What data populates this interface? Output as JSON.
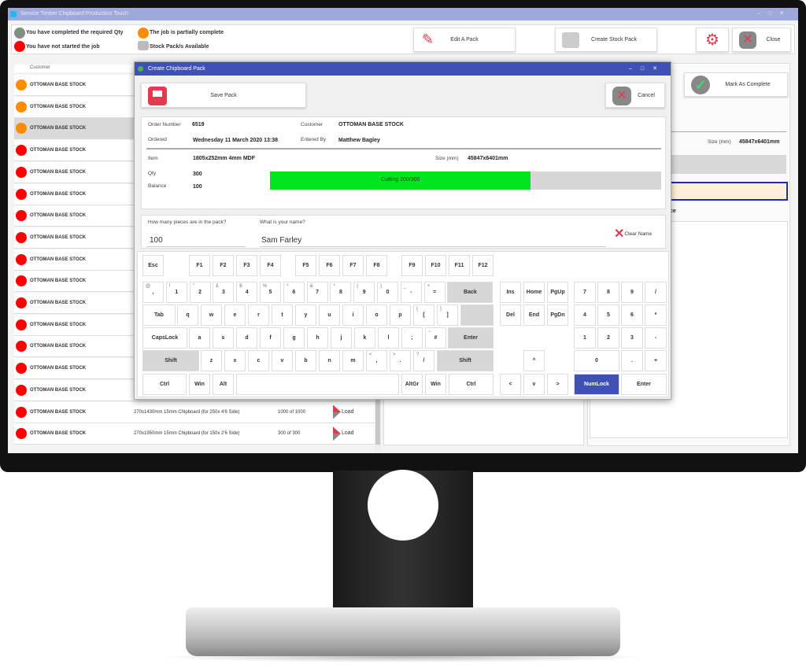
{
  "window": {
    "title": "Service Timber Chipboard Production Touch"
  },
  "legend": {
    "completed": "You have completed the required Qty",
    "partial": "The job is partially complete",
    "not_started": "You have not started the job",
    "stock_pack": "Stock Pack/s Available"
  },
  "toolbar": {
    "edit_pack": "Edit A Pack",
    "create_stock_pack": "Create Stock Pack",
    "close": "Close"
  },
  "list": {
    "header": "Customer",
    "rows": [
      {
        "customer": "OTTOMAN BASE STOCK",
        "status": "orange"
      },
      {
        "customer": "OTTOMAN BASE STOCK",
        "status": "orange"
      },
      {
        "customer": "OTTOMAN BASE STOCK",
        "status": "orange",
        "selected": true
      },
      {
        "customer": "OTTOMAN BASE STOCK",
        "status": "red"
      },
      {
        "customer": "OTTOMAN BASE STOCK",
        "status": "red"
      },
      {
        "customer": "OTTOMAN BASE STOCK",
        "status": "red"
      },
      {
        "customer": "OTTOMAN BASE STOCK",
        "status": "red"
      },
      {
        "customer": "OTTOMAN BASE STOCK",
        "status": "red"
      },
      {
        "customer": "OTTOMAN BASE STOCK",
        "status": "red"
      },
      {
        "customer": "OTTOMAN BASE STOCK",
        "status": "red"
      },
      {
        "customer": "OTTOMAN BASE STOCK",
        "status": "red"
      },
      {
        "customer": "OTTOMAN BASE STOCK",
        "status": "red"
      },
      {
        "customer": "OTTOMAN BASE STOCK",
        "status": "red"
      },
      {
        "customer": "OTTOMAN BASE STOCK",
        "status": "red"
      },
      {
        "customer": "OTTOMAN BASE STOCK",
        "status": "red"
      },
      {
        "customer": "OTTOMAN BASE STOCK",
        "status": "red",
        "item": "270x1430mm 15mm Chipboard (for 250x 4'6 Side)",
        "qty": "1000 of 1000",
        "action": "Load"
      },
      {
        "customer": "OTTOMAN BASE STOCK",
        "status": "red",
        "item": "270x1950mm 15mm Chipboard (for 150x 2'6 Side)",
        "qty": "300 of 300",
        "action": "Load"
      }
    ]
  },
  "right": {
    "mark_complete": "Mark As Complete",
    "size_label": "Size (mm)",
    "size_value": "45847x6401mm",
    "progress": 0.667,
    "partial_label": "ce"
  },
  "dialog": {
    "title": "Create Chipboard Pack",
    "save": "Save Pack",
    "cancel": "Cancel",
    "order_number_label": "Order Number",
    "order_number": "6519",
    "customer_label": "Customer",
    "customer": "OTTOMAN BASE STOCK",
    "ordered_label": "Ordered",
    "ordered": "Wednesday 11 March 2020 13:38",
    "entered_by_label": "Entered By",
    "entered_by": "Matthew Bagley",
    "item_label": "Item",
    "item": "1805x252mm 4mm MDF",
    "size_label": "Size (mm)",
    "size": "45847x6401mm",
    "qty_label": "Qty",
    "qty": "300",
    "balance_label": "Balance",
    "balance": "100",
    "progress_text": "Cutting 200/300",
    "progress": 0.667,
    "pieces_label": "How many pieces are in the pack?",
    "pieces_value": "100",
    "name_label": "What is your name?",
    "name_value": "Sam Farley",
    "clear_name": "Clear Name"
  },
  "colors": {
    "accent": "#3f51b5",
    "green": "#00e61e",
    "red": "#ff0000",
    "orange": "#ff8c00"
  },
  "keyboard": {
    "fn": [
      "Esc",
      "F1",
      "F2",
      "F3",
      "F4",
      "F5",
      "F6",
      "F7",
      "F8",
      "F9",
      "F10",
      "F11",
      "F12"
    ],
    "row2": [
      [
        "@",
        ","
      ],
      [
        "!",
        "1"
      ],
      [
        "\"",
        "2"
      ],
      [
        "£",
        "3"
      ],
      [
        "$",
        "4"
      ],
      [
        "%",
        "5"
      ],
      [
        "^",
        "6"
      ],
      [
        "&",
        "7"
      ],
      [
        "*",
        "8"
      ],
      [
        "(",
        "9"
      ],
      [
        ")",
        "0"
      ],
      [
        "_",
        "-"
      ],
      [
        "+",
        "="
      ],
      [
        "",
        "Back"
      ]
    ],
    "row3": [
      [
        "",
        "Tab"
      ],
      [
        "",
        "q"
      ],
      [
        "",
        "w"
      ],
      [
        "",
        "e"
      ],
      [
        "",
        "r"
      ],
      [
        "",
        "t"
      ],
      [
        "",
        "y"
      ],
      [
        "",
        "u"
      ],
      [
        "",
        "i"
      ],
      [
        "",
        "o"
      ],
      [
        "",
        "p"
      ],
      [
        "{",
        "["
      ],
      [
        "}",
        "]"
      ],
      [
        "",
        ""
      ]
    ],
    "row4": [
      [
        "",
        "CapsLock"
      ],
      [
        "",
        "a"
      ],
      [
        "",
        "s"
      ],
      [
        "",
        "d"
      ],
      [
        "",
        "f"
      ],
      [
        "",
        "g"
      ],
      [
        "",
        "h"
      ],
      [
        "",
        "j"
      ],
      [
        "",
        "k"
      ],
      [
        "",
        "l"
      ],
      [
        ":",
        ";"
      ],
      [
        "~",
        "#"
      ],
      [
        "",
        "Enter"
      ]
    ],
    "row5": [
      [
        "",
        "Shift"
      ],
      [
        "",
        "z"
      ],
      [
        "",
        "x"
      ],
      [
        "",
        "c"
      ],
      [
        "",
        "v"
      ],
      [
        "",
        "b"
      ],
      [
        "",
        "n"
      ],
      [
        "",
        "m"
      ],
      [
        "<",
        ","
      ],
      [
        ">",
        "."
      ],
      [
        "?",
        "/"
      ],
      [
        "",
        "Shift"
      ]
    ],
    "row6": [
      "Ctrl",
      "Win",
      "Alt",
      "",
      "AltGr",
      "Win",
      "Ctrl"
    ],
    "nav": [
      "Ins",
      "Home",
      "PgUp",
      "Del",
      "End",
      "PgDn",
      "^",
      "<",
      "v",
      ">"
    ],
    "numpad": [
      "7",
      "8",
      "9",
      "/",
      "4",
      "5",
      "6",
      "*",
      "1",
      "2",
      "3",
      "-",
      "0",
      ".",
      "+",
      "NumLock",
      "Enter"
    ]
  }
}
